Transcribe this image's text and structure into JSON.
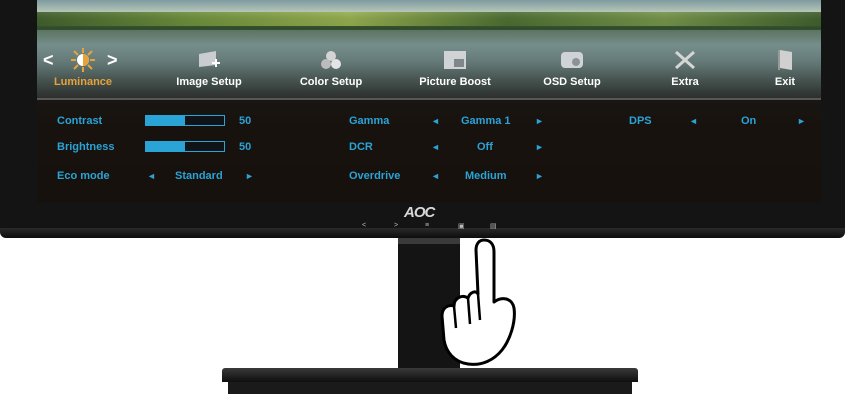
{
  "menu": {
    "items": [
      {
        "label": "Luminance",
        "icon": "sun-icon",
        "active": true
      },
      {
        "label": "Image Setup",
        "icon": "image-setup-icon"
      },
      {
        "label": "Color Setup",
        "icon": "color-setup-icon"
      },
      {
        "label": "Picture Boost",
        "icon": "picture-boost-icon"
      },
      {
        "label": "OSD Setup",
        "icon": "osd-setup-icon"
      },
      {
        "label": "Extra",
        "icon": "extra-icon"
      },
      {
        "label": "Exit",
        "icon": "exit-icon"
      }
    ],
    "prev_arrow": "<",
    "next_arrow": ">"
  },
  "settings": {
    "contrast": {
      "label": "Contrast",
      "value": "50",
      "level": 0.5
    },
    "brightness": {
      "label": "Brightness",
      "value": "50",
      "level": 0.5
    },
    "eco_mode": {
      "label": "Eco mode",
      "value": "Standard"
    },
    "gamma": {
      "label": "Gamma",
      "value": "Gamma 1"
    },
    "dcr": {
      "label": "DCR",
      "value": "Off"
    },
    "overdrive": {
      "label": "Overdrive",
      "value": "Medium"
    },
    "dps": {
      "label": "DPS",
      "value": "On"
    },
    "arrow_left": "◄",
    "arrow_right": "►"
  },
  "bezel": {
    "logo": "AOC",
    "buttons": [
      "<",
      ">",
      "≡",
      "▣",
      "▤"
    ]
  },
  "colors": {
    "accent": "#2aa3d6",
    "active_tab": "#e8a23b"
  }
}
